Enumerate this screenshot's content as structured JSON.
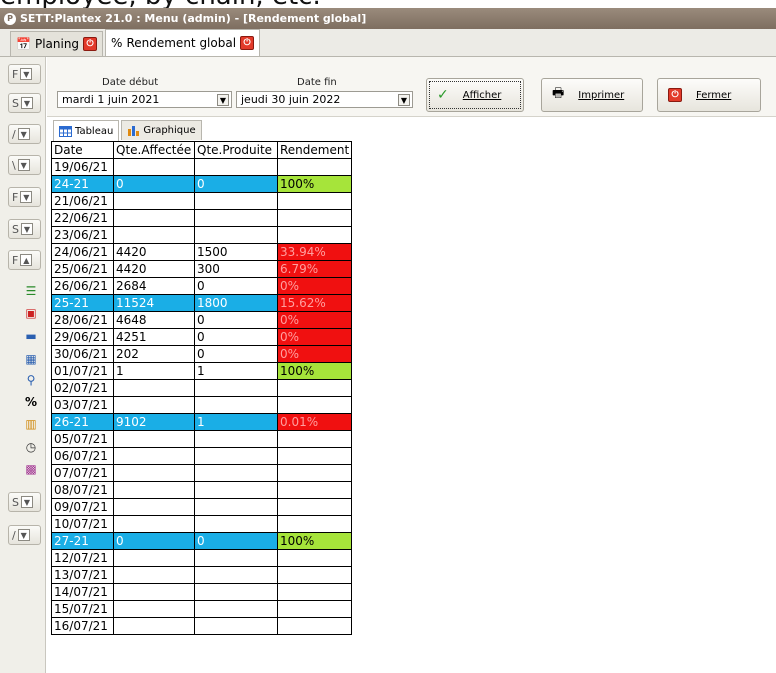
{
  "caption_fragment": "employee, by chain, etc.",
  "window": {
    "title": "SETT:Plantex 21.0 : Menu (admin) - [Rendement global]"
  },
  "doc_tabs": [
    {
      "label": "Planing"
    },
    {
      "label": "Rendement global"
    }
  ],
  "filters": {
    "start_label": "Date début",
    "start_value": "mardi 1 juin 2021",
    "end_label": "Date fin",
    "end_value": "jeudi 30 juin 2022"
  },
  "actions": {
    "show": "Afficher",
    "print": "Imprimer",
    "close": "Fermer"
  },
  "view_tabs": {
    "table": "Tableau",
    "chart": "Graphique"
  },
  "grid": {
    "headers": [
      "Date",
      "Qte.Affectée",
      "Qte.Produite",
      "Rendement"
    ],
    "rows": [
      {
        "date": "19/06/21",
        "affectee": "",
        "produite": "",
        "rendement": "",
        "kind": "day"
      },
      {
        "date": "24-21",
        "affectee": "0",
        "produite": "0",
        "rendement": "100%",
        "kind": "week",
        "status": "green"
      },
      {
        "date": "21/06/21",
        "affectee": "",
        "produite": "",
        "rendement": "",
        "kind": "day"
      },
      {
        "date": "22/06/21",
        "affectee": "",
        "produite": "",
        "rendement": "",
        "kind": "day"
      },
      {
        "date": "23/06/21",
        "affectee": "",
        "produite": "",
        "rendement": "",
        "kind": "day"
      },
      {
        "date": "24/06/21",
        "affectee": "4420",
        "produite": "1500",
        "rendement": "33.94%",
        "kind": "day",
        "status": "red"
      },
      {
        "date": "25/06/21",
        "affectee": "4420",
        "produite": "300",
        "rendement": "6.79%",
        "kind": "day",
        "status": "red"
      },
      {
        "date": "26/06/21",
        "affectee": "2684",
        "produite": "0",
        "rendement": "0%",
        "kind": "day",
        "status": "red"
      },
      {
        "date": "25-21",
        "affectee": "11524",
        "produite": "1800",
        "rendement": "15.62%",
        "kind": "week",
        "status": "red"
      },
      {
        "date": "28/06/21",
        "affectee": "4648",
        "produite": "0",
        "rendement": "0%",
        "kind": "day",
        "status": "red"
      },
      {
        "date": "29/06/21",
        "affectee": "4251",
        "produite": "0",
        "rendement": "0%",
        "kind": "day",
        "status": "red"
      },
      {
        "date": "30/06/21",
        "affectee": "202",
        "produite": "0",
        "rendement": "0%",
        "kind": "day",
        "status": "red"
      },
      {
        "date": "01/07/21",
        "affectee": "1",
        "produite": "1",
        "rendement": "100%",
        "kind": "day",
        "status": "green"
      },
      {
        "date": "02/07/21",
        "affectee": "",
        "produite": "",
        "rendement": "",
        "kind": "day"
      },
      {
        "date": "03/07/21",
        "affectee": "",
        "produite": "",
        "rendement": "",
        "kind": "day"
      },
      {
        "date": "26-21",
        "affectee": "9102",
        "produite": "1",
        "rendement": "0.01%",
        "kind": "week",
        "status": "red"
      },
      {
        "date": "05/07/21",
        "affectee": "",
        "produite": "",
        "rendement": "",
        "kind": "day"
      },
      {
        "date": "06/07/21",
        "affectee": "",
        "produite": "",
        "rendement": "",
        "kind": "day"
      },
      {
        "date": "07/07/21",
        "affectee": "",
        "produite": "",
        "rendement": "",
        "kind": "day"
      },
      {
        "date": "08/07/21",
        "affectee": "",
        "produite": "",
        "rendement": "",
        "kind": "day"
      },
      {
        "date": "09/07/21",
        "affectee": "",
        "produite": "",
        "rendement": "",
        "kind": "day"
      },
      {
        "date": "10/07/21",
        "affectee": "",
        "produite": "",
        "rendement": "",
        "kind": "day"
      },
      {
        "date": "27-21",
        "affectee": "0",
        "produite": "0",
        "rendement": "100%",
        "kind": "week",
        "status": "green"
      },
      {
        "date": "12/07/21",
        "affectee": "",
        "produite": "",
        "rendement": "",
        "kind": "day"
      },
      {
        "date": "13/07/21",
        "affectee": "",
        "produite": "",
        "rendement": "",
        "kind": "day"
      },
      {
        "date": "14/07/21",
        "affectee": "",
        "produite": "",
        "rendement": "",
        "kind": "day"
      },
      {
        "date": "15/07/21",
        "affectee": "",
        "produite": "",
        "rendement": "",
        "kind": "day"
      },
      {
        "date": "16/07/21",
        "affectee": "",
        "produite": "",
        "rendement": "",
        "kind": "day"
      }
    ]
  },
  "colors": {
    "week_row": "#1aaee6",
    "ok": "#a6e43a",
    "bad": "#f01010"
  }
}
